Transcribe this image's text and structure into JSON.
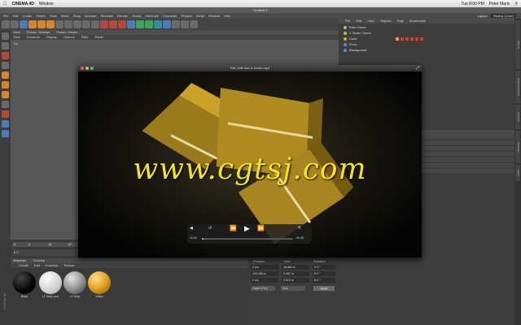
{
  "mac_menubar": {
    "app": "CINEMA 4D",
    "items": [
      "Window"
    ],
    "clock": "Tue 8:00 PM",
    "user": "Peter Maric"
  },
  "c4d": {
    "title": "Untitled 3",
    "menus": [
      "File",
      "Edit",
      "Create",
      "Select",
      "Tools",
      "Mesh",
      "Snap",
      "Animate",
      "Simulate",
      "Render",
      "Sculpt",
      "MoGraph",
      "Character",
      "Plugins",
      "Script",
      "Window",
      "Help"
    ],
    "layout_label": "Layout:",
    "layout_value": "Startup (User)",
    "viewport_tabs": [
      "View",
      "Render Settings",
      "Picture Viewer"
    ],
    "viewport_menu": [
      "View",
      "Cameras",
      "Display",
      "Options",
      "Filter",
      "Panel"
    ],
    "viewport_label": "Top"
  },
  "objects": {
    "menu": [
      "File",
      "Edit",
      "View",
      "Objects",
      "Tags",
      "Bookmarks"
    ],
    "items": [
      {
        "name": "Rise Cloner",
        "color": "#9acb55"
      },
      {
        "name": "X Slider Cloner",
        "color": "#9acb55"
      },
      {
        "name": "Cube",
        "color": "#e0a23a"
      },
      {
        "name": "Floor",
        "color": "#4a8fd8"
      },
      {
        "name": "Background",
        "color": "#4a8fd8"
      }
    ]
  },
  "timeline": {
    "marks": [
      "0",
      "5",
      "10",
      "15"
    ],
    "current_frame": "0 F"
  },
  "materials": {
    "tabs": [
      "Materials",
      "Timeline"
    ],
    "menu": [
      "Create",
      "Edit",
      "Function",
      "Texture"
    ],
    "items": [
      {
        "name": "Black",
        "color": "#0a0a0a"
      },
      {
        "name": "LT Grey Lum",
        "color": "#e8e8e8"
      },
      {
        "name": "LT Grey",
        "color": "#9a9a9a"
      },
      {
        "name": "Yellow",
        "color": "#e0a020"
      }
    ]
  },
  "coordinates": {
    "headers": [
      "Position",
      "Size",
      "Rotation"
    ],
    "rows": [
      {
        "axis": "X",
        "pos": "0 cm",
        "size": "18.682 m",
        "rot": "H 0 °"
      },
      {
        "axis": "Y",
        "pos": "425.456 m",
        "size": "0.457 m",
        "rot": "P 0 °"
      },
      {
        "axis": "Z",
        "pos": "0 cm",
        "size": "0.574 m",
        "rot": "B 0 °"
      }
    ],
    "mode": "Object (Rel)",
    "size_mode": "Size",
    "apply": "Apply"
  },
  "cinema_logo": "CINEMA 4D",
  "right_tabs": [
    "Objects",
    "Content Browser",
    "Structure",
    "Attributes",
    "Layers"
  ],
  "player": {
    "title": "GM_Half size w music.mp4",
    "watermark": "www.cgtsj.com",
    "time_elapsed": "00:00",
    "time_remaining": "-00:28",
    "progress": 0.02,
    "colors": {
      "box": "#c9a227",
      "box_dark": "#8a6d12",
      "watermark": "#f2e418"
    }
  }
}
